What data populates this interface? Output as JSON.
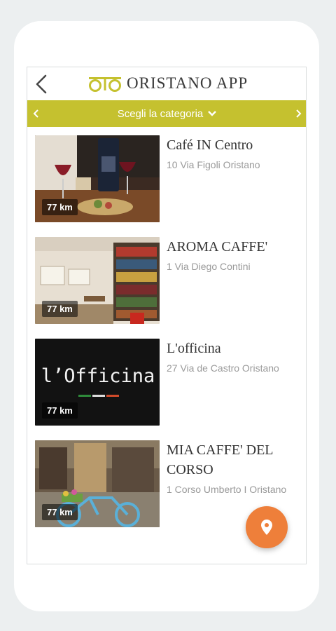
{
  "header": {
    "app_title": "ORISTANO APP",
    "back_icon": "back-arrow-icon",
    "logo_icon": "oristano-logo-icon"
  },
  "category_bar": {
    "label": "Scegli la categoria",
    "prev_icon": "chevron-left-icon",
    "next_icon": "chevron-right-icon",
    "dropdown_icon": "chevron-down-icon",
    "color": "#c5c12f"
  },
  "places": [
    {
      "name": "Café IN Centro",
      "address": "10 Via Figoli Oristano",
      "distance": "77 km"
    },
    {
      "name": "AROMA CAFFE'",
      "address": "1 Via Diego Contini",
      "distance": "77 km"
    },
    {
      "name": "L'officina",
      "address": "27 Via de Castro Oristano",
      "distance": "77 km",
      "image_text": "l’Officina"
    },
    {
      "name": "MIA CAFFE' DEL CORSO",
      "address": "1 Corso Umberto I Oristano",
      "distance": "77 km"
    }
  ],
  "fab": {
    "icon": "map-pin-icon",
    "color": "#ee7f3a"
  }
}
